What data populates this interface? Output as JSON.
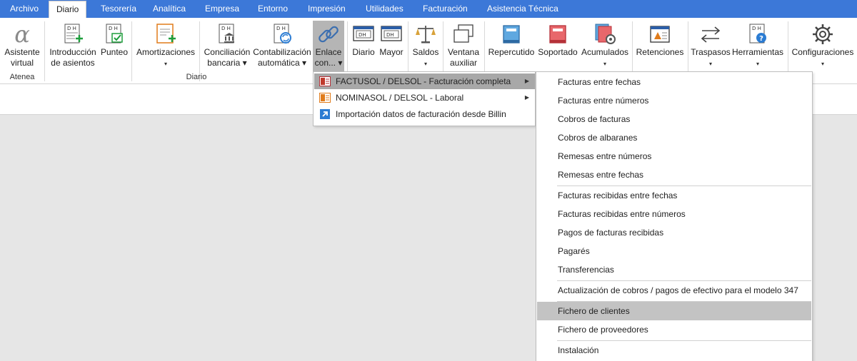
{
  "tabs": [
    {
      "label": "Archivo"
    },
    {
      "label": "Diario"
    },
    {
      "label": "Tesorería"
    },
    {
      "label": "Analítica"
    },
    {
      "label": "Empresa"
    },
    {
      "label": "Entorno"
    },
    {
      "label": "Impresión"
    },
    {
      "label": "Utilidades"
    },
    {
      "label": "Facturación"
    },
    {
      "label": "Asistencia Técnica"
    }
  ],
  "active_tab": "Diario",
  "ribbon": {
    "buttons": [
      {
        "line1": "Asistente",
        "line2": "virtual",
        "icon": "alpha-icon"
      },
      {
        "line1": "Introducción",
        "line2": "de asientos",
        "icon": "new-entry-icon"
      },
      {
        "line1": "Punteo",
        "line2": "",
        "icon": "check-entry-icon"
      },
      {
        "line1": "Amortizaciones",
        "line2": "▾",
        "icon": "amortization-icon"
      },
      {
        "line1": "Conciliación",
        "line2": "bancaria ▾",
        "icon": "bank-icon"
      },
      {
        "line1": "Contabilización",
        "line2": "automática ▾",
        "icon": "auto-post-icon"
      },
      {
        "line1": "Enlace",
        "line2": "con... ▾",
        "icon": "link-icon"
      },
      {
        "line1": "Diario",
        "line2": "",
        "icon": "journal-icon"
      },
      {
        "line1": "Mayor",
        "line2": "",
        "icon": "ledger-icon"
      },
      {
        "line1": "Saldos",
        "line2": "▾",
        "icon": "balance-scale-icon"
      },
      {
        "line1": "Ventana",
        "line2": "auxiliar",
        "icon": "window-icon"
      },
      {
        "line1": "Repercutido",
        "line2": "",
        "icon": "book-blue-icon"
      },
      {
        "line1": "Soportado",
        "line2": "",
        "icon": "book-red-icon"
      },
      {
        "line1": "Acumulados",
        "line2": "▾",
        "icon": "book-gear-icon"
      },
      {
        "line1": "Retenciones",
        "line2": "",
        "icon": "withholding-icon"
      },
      {
        "line1": "Traspasos",
        "line2": "▾",
        "icon": "transfer-arrows-icon"
      },
      {
        "line1": "Herramientas",
        "line2": "▾",
        "icon": "tools-icon"
      },
      {
        "line1": "Configuraciones",
        "line2": "▾",
        "icon": "gear-icon"
      }
    ],
    "groups": {
      "atenea": "Atenea",
      "diario": "Diario"
    }
  },
  "menu1": {
    "items": [
      {
        "label": "FACTUSOL / DELSOL - Facturación completa",
        "icon": "factusol-icon",
        "submenu": true
      },
      {
        "label": "NOMINASOL / DELSOL - Laboral",
        "icon": "nominasol-icon",
        "submenu": true
      },
      {
        "label": "Importación datos de facturación desde Billin",
        "icon": "import-arrow-icon",
        "submenu": false
      }
    ]
  },
  "menu2": {
    "items": [
      "Facturas entre fechas",
      "Facturas entre números",
      "Cobros de facturas",
      "Cobros de albaranes",
      "Remesas entre números",
      "Remesas entre fechas",
      "Facturas recibidas entre fechas",
      "Facturas recibidas entre números",
      "Pagos de facturas recibidas",
      "Pagarés",
      "Transferencias",
      "Actualización de cobros / pagos de efectivo para el modelo 347",
      "Fichero de clientes",
      "Fichero de proveedores",
      "Instalación"
    ]
  },
  "colors": {
    "tabbar": "#3c78d8",
    "highlight": "#c3c3c3",
    "pressed": "#b5b5b5"
  }
}
